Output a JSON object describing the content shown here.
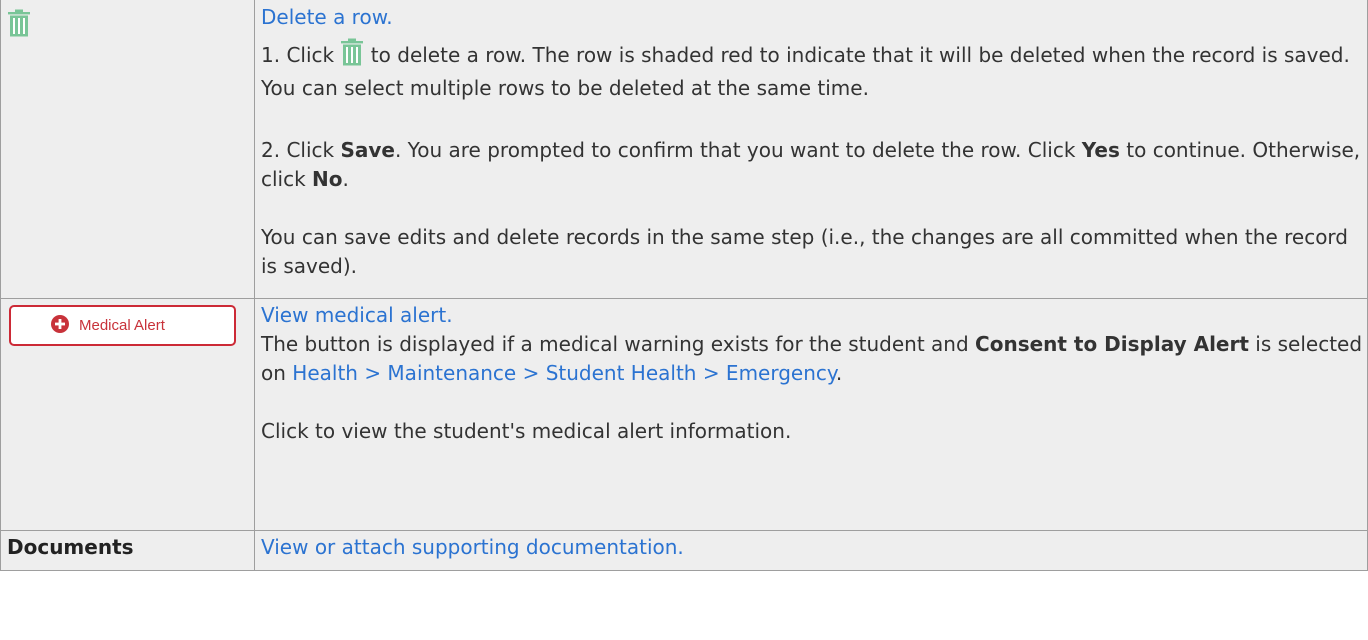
{
  "rows": [
    {
      "icon": "trash-icon",
      "link": "Delete a row.",
      "step1_pre": "1. Click ",
      "step1_post": " to delete a row. The row is shaded red to indicate that it will be deleted when the record is saved. You can select multiple rows to be deleted at the same time.",
      "step2_pre": "2. Click ",
      "step2_bold1": "Save",
      "step2_mid": ". You are prompted to confirm that you want to delete the row. Click ",
      "step2_bold2": "Yes",
      "step2_mid2": " to continue. Otherwise, click ",
      "step2_bold3": "No",
      "step2_end": ".",
      "note": "You can save edits and delete records in the same step (i.e., the changes are all committed when the record is saved)."
    },
    {
      "button_label": "Medical Alert",
      "button_icon": "plus-circle-icon",
      "link": "View medical alert.",
      "desc_pre": "The button is displayed if a medical warning exists for the student and ",
      "desc_bold": "Consent to Display Alert",
      "desc_mid": " is selected on ",
      "desc_link": "Health > Maintenance > Student Health > Emergency",
      "desc_end": ".",
      "note": "Click to view the student's medical alert information."
    },
    {
      "label": "Documents",
      "link": "View or attach supporting documentation."
    }
  ],
  "colors": {
    "link": "#2b73d1",
    "cell_bg": "#eeeeee",
    "border": "#9e9e9e",
    "trash": "#79c597",
    "alert_red": "#cc2a36"
  }
}
